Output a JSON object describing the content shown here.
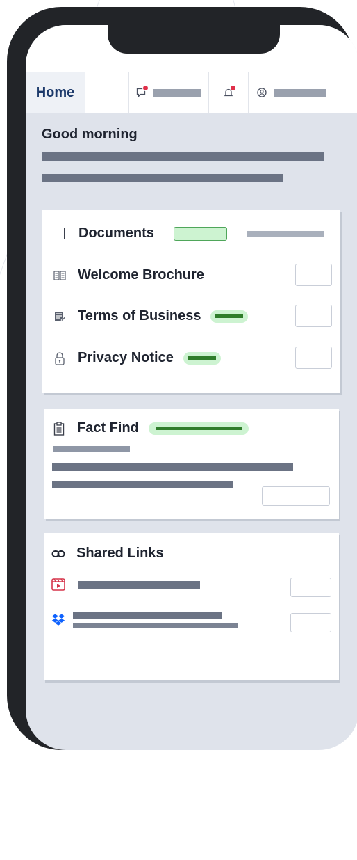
{
  "nav": {
    "home_label": "Home"
  },
  "greeting": "Good morning",
  "documents": {
    "title": "Documents",
    "items": [
      {
        "label": "Welcome Brochure",
        "icon": "book-icon"
      },
      {
        "label": "Terms of Business",
        "icon": "contract-icon"
      },
      {
        "label": "Privacy Notice",
        "icon": "lock-icon"
      }
    ]
  },
  "fact_find": {
    "title": "Fact Find"
  },
  "shared_links": {
    "title": "Shared Links",
    "items": [
      {
        "icon": "video-icon"
      },
      {
        "icon": "dropbox-icon"
      }
    ]
  },
  "colors": {
    "brand": "#1d3a6b",
    "notification": "#e0304a",
    "status_bg": "#cdf3d1",
    "status_bar": "#2f7d2a",
    "video": "#d6344a",
    "dropbox": "#0f62fe"
  }
}
